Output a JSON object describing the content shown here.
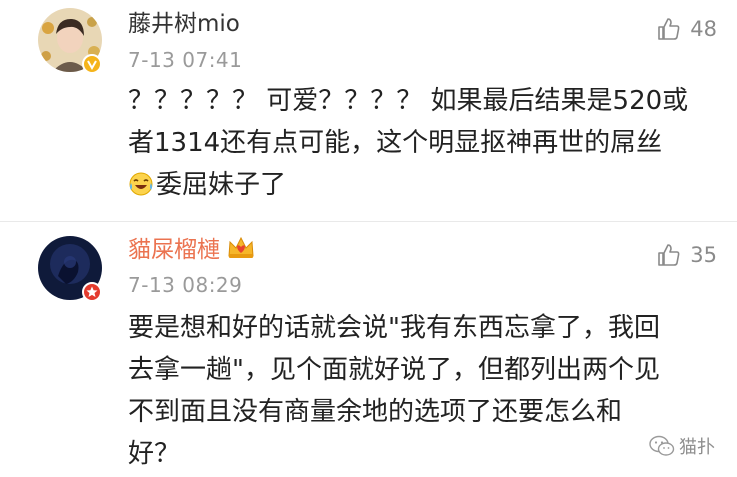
{
  "comments": [
    {
      "username": "藤井树mio",
      "time": "7-13 07:41",
      "likes": "48",
      "verified_badge": "gold-v-badge-icon",
      "content_lines": [
        "？？？？？ 可爱？？？？ 如果最后结果是520或",
        "者1314还有点可能，这个明显抠神再世的屌丝",
        "委屈妹子了"
      ],
      "emoji": "laughing-crying-emoji-icon"
    },
    {
      "username": "貓屎榴槤",
      "time": "7-13 08:29",
      "likes": "35",
      "verified_badge": "red-star-badge-icon",
      "member_icon": "crown-icon",
      "content_lines": [
        "要是想和好的话就会说\"我有东西忘拿了，我回",
        "去拿一趟\"，见个面就好说了，但都列出两个见",
        "不到面且没有商量余地的选项了还要怎么和",
        "好？"
      ]
    }
  ],
  "watermark": {
    "text": "猫扑",
    "icon": "wechat-icon"
  },
  "colors": {
    "username_default": "#333333",
    "username_vip": "#eb7350",
    "meta_gray": "#9a9a9a",
    "divider": "#e9e9e9"
  }
}
